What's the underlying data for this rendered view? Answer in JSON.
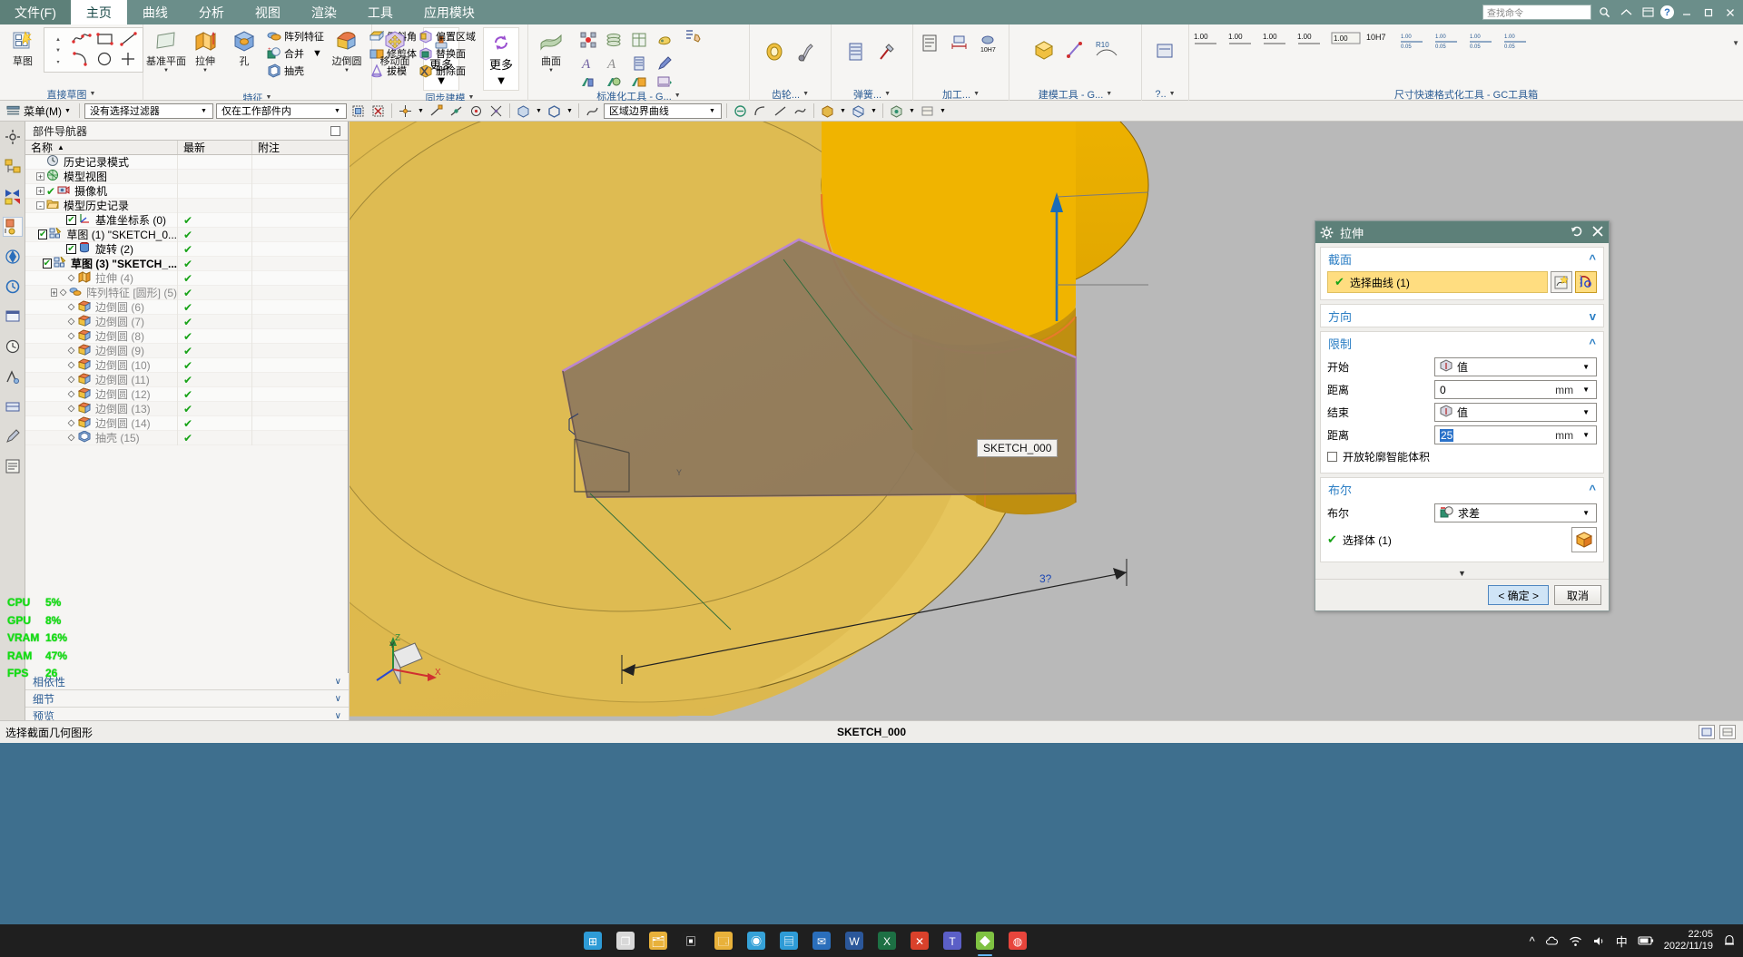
{
  "menubar": {
    "file_label": "文件(F)",
    "tabs": [
      {
        "label": "主页",
        "active": true
      },
      {
        "label": "曲线",
        "active": false
      },
      {
        "label": "分析",
        "active": false
      },
      {
        "label": "视图",
        "active": false
      },
      {
        "label": "渲染",
        "active": false
      },
      {
        "label": "工具",
        "active": false
      },
      {
        "label": "应用模块",
        "active": false
      }
    ],
    "search_placeholder": "查找命令",
    "window_controls": [
      "minimize",
      "maximize",
      "close"
    ]
  },
  "ribbon": {
    "groups": [
      {
        "label": "直接草图",
        "big": [
          {
            "label": "草图",
            "icon": "sketch-icon"
          }
        ],
        "grid": [
          "spline-icon",
          "rectangle-icon",
          "line-icon",
          "arc-icon",
          "circle-icon",
          "point-icon"
        ]
      },
      {
        "label": "特征",
        "big": [
          {
            "label": "基准平面",
            "icon": "datum-plane-icon",
            "dropdown": true
          },
          {
            "label": "拉伸",
            "icon": "extrude-icon",
            "dropdown": true
          },
          {
            "label": "孔",
            "icon": "hole-icon",
            "dropdown": false
          }
        ],
        "small": [
          "阵列特征",
          "合并",
          "抽壳"
        ],
        "big2": [
          {
            "label": "边倒圆",
            "icon": "edge-blend-icon",
            "dropdown": true
          }
        ],
        "small2": [
          "倒斜角",
          "修剪体",
          "拔模"
        ],
        "more": "更多"
      },
      {
        "label": "同步建模",
        "big": [
          {
            "label": "移动面",
            "icon": "move-face-icon"
          }
        ],
        "small": [
          "偏置区域",
          "替换面",
          "删除面"
        ],
        "more": "更多"
      },
      {
        "label": "标准化工具 - G...",
        "big": [
          {
            "label": "曲面",
            "icon": "surface-icon",
            "dropdown": true
          }
        ],
        "icons": [
          "pattern-icon",
          "layers-icon",
          "table-icon",
          "tag-icon",
          "text-a-icon",
          "text-b-icon",
          "stack-icon",
          "pen-icon"
        ]
      },
      {
        "label": "齿轮..."
      },
      {
        "label": "弹簧..."
      },
      {
        "label": "加工..."
      },
      {
        "label": "建模工具 - G..."
      },
      {
        "label": "?.."
      },
      {
        "label": "尺寸快速格式化工具 - GC工具箱"
      }
    ]
  },
  "selbar": {
    "menu_label": "菜单(M)",
    "filter_value": "没有选择过滤器",
    "scope_value": "仅在工作部件内",
    "curve_rule_value": "区域边界曲线"
  },
  "part_navigator": {
    "title": "部件导航器",
    "columns": [
      "名称",
      "最新",
      "附注"
    ],
    "sort_indicator": "▲",
    "items": [
      {
        "label": "历史记录模式",
        "icon": "clock-icon",
        "indent": 0,
        "mark": "none",
        "latest": "",
        "style": "normal",
        "expander": ""
      },
      {
        "label": "模型视图",
        "icon": "model-view-icon",
        "indent": 0,
        "mark": "none",
        "latest": "",
        "style": "normal",
        "expander": "+"
      },
      {
        "label": "摄像机",
        "icon": "camera-icon",
        "indent": 0,
        "mark": "check",
        "latest": "",
        "style": "normal",
        "expander": "+"
      },
      {
        "label": "模型历史记录",
        "icon": "folder-icon",
        "indent": 0,
        "mark": "none",
        "latest": "",
        "style": "normal",
        "expander": "-"
      },
      {
        "label": "基准坐标系 (0)",
        "icon": "csys-icon",
        "indent": 1,
        "mark": "checkbox",
        "latest": "✔",
        "style": "normal",
        "expander": ""
      },
      {
        "label": "草图 (1) \"SKETCH_0...",
        "icon": "sketch-small-icon",
        "indent": 1,
        "mark": "checkbox",
        "latest": "✔",
        "style": "normal",
        "expander": ""
      },
      {
        "label": "旋转 (2)",
        "icon": "revolve-icon",
        "indent": 1,
        "mark": "checkbox",
        "latest": "✔",
        "style": "normal",
        "expander": ""
      },
      {
        "label": "草图 (3) \"SKETCH_...",
        "icon": "sketch-small-icon",
        "indent": 1,
        "mark": "checkbox",
        "latest": "✔",
        "style": "bold",
        "expander": ""
      },
      {
        "label": "拉伸 (4)",
        "icon": "extrude-small-icon",
        "indent": 1,
        "mark": "diamond",
        "latest": "✔",
        "style": "grey",
        "expander": ""
      },
      {
        "label": "阵列特征 [圆形] (5)",
        "icon": "pattern-small-icon",
        "indent": 1,
        "mark": "diamond",
        "latest": "✔",
        "style": "grey",
        "expander": "+"
      },
      {
        "label": "边倒圆 (6)",
        "icon": "blend-small-icon",
        "indent": 1,
        "mark": "diamond",
        "latest": "✔",
        "style": "grey",
        "expander": ""
      },
      {
        "label": "边倒圆 (7)",
        "icon": "blend-small-icon",
        "indent": 1,
        "mark": "diamond",
        "latest": "✔",
        "style": "grey",
        "expander": ""
      },
      {
        "label": "边倒圆 (8)",
        "icon": "blend-small-icon",
        "indent": 1,
        "mark": "diamond",
        "latest": "✔",
        "style": "grey",
        "expander": ""
      },
      {
        "label": "边倒圆 (9)",
        "icon": "blend-small-icon",
        "indent": 1,
        "mark": "diamond",
        "latest": "✔",
        "style": "grey",
        "expander": ""
      },
      {
        "label": "边倒圆 (10)",
        "icon": "blend-small-icon",
        "indent": 1,
        "mark": "diamond",
        "latest": "✔",
        "style": "grey",
        "expander": ""
      },
      {
        "label": "边倒圆 (11)",
        "icon": "blend-small-icon",
        "indent": 1,
        "mark": "diamond",
        "latest": "✔",
        "style": "grey",
        "expander": ""
      },
      {
        "label": "边倒圆 (12)",
        "icon": "blend-small-icon",
        "indent": 1,
        "mark": "diamond",
        "latest": "✔",
        "style": "grey",
        "expander": ""
      },
      {
        "label": "边倒圆 (13)",
        "icon": "blend-small-icon",
        "indent": 1,
        "mark": "diamond",
        "latest": "✔",
        "style": "grey",
        "expander": ""
      },
      {
        "label": "边倒圆 (14)",
        "icon": "blend-small-icon",
        "indent": 1,
        "mark": "diamond",
        "latest": "✔",
        "style": "grey",
        "expander": ""
      },
      {
        "label": "抽壳 (15)",
        "icon": "shell-small-icon",
        "indent": 1,
        "mark": "diamond",
        "latest": "✔",
        "style": "grey",
        "expander": ""
      }
    ],
    "collapsers": [
      "相依性",
      "细节",
      "预览"
    ]
  },
  "perf_overlay": {
    "color": "#13e013",
    "rows": [
      {
        "key": "CPU",
        "value": "5%"
      },
      {
        "key": "GPU",
        "value": "8%"
      },
      {
        "key": "VRAM",
        "value": "16%"
      },
      {
        "key": "RAM",
        "value": "47%"
      },
      {
        "key": "FPS",
        "value": "26"
      }
    ]
  },
  "graphics": {
    "sketch_tag": "SKETCH_000",
    "dimension_value": "3?",
    "triad_labels": {
      "x": "X",
      "y": "Y",
      "z": "Z"
    },
    "background_color": "#b9b9b9",
    "body_color": "#e3b83a",
    "accent_color": "#f0a500"
  },
  "dialog": {
    "title": "拉伸",
    "title_icon": "gear-icon",
    "reset_icon": "reset-icon",
    "close_icon": "close-icon",
    "sections": [
      {
        "name": "截面",
        "expanded": true,
        "select_label": "选择曲线 (1)",
        "select_check": "✔",
        "buttons": [
          "specify-curve-icon",
          "sketch-section-icon"
        ]
      },
      {
        "name": "方向",
        "expanded": false
      },
      {
        "name": "限制",
        "expanded": true,
        "fields": [
          {
            "label": "开始",
            "type": "select",
            "value": "值",
            "icon": "value-icon"
          },
          {
            "label": "距离",
            "type": "number",
            "value": "0",
            "unit": "mm",
            "selected": false
          },
          {
            "label": "结束",
            "type": "select",
            "value": "值",
            "icon": "value-icon"
          },
          {
            "label": "距离",
            "type": "number",
            "value": "25",
            "unit": "mm",
            "selected": true
          }
        ],
        "checkbox": {
          "label": "开放轮廓智能体积",
          "checked": false
        }
      },
      {
        "name": "布尔",
        "expanded": true,
        "fields": [
          {
            "label": "布尔",
            "type": "select",
            "value": "求差",
            "icon": "subtract-icon"
          }
        ],
        "select_label": "选择体 (1)",
        "select_check": "✔",
        "body_button": "body-icon"
      }
    ],
    "more_arrow": "▼",
    "ok_label": "< 确定 >",
    "cancel_label": "取消"
  },
  "status_bar": {
    "message": "选择截面几何图形",
    "center_label": "SKETCH_000"
  },
  "taskbar": {
    "items": [
      {
        "name": "start-icon",
        "glyph": "⊞",
        "color": "#2e9bd6"
      },
      {
        "name": "task-view-icon",
        "glyph": "❐",
        "color": "#d8d8d8"
      },
      {
        "name": "explorer-icon",
        "glyph": "🗂",
        "color": "#e8b13a"
      },
      {
        "name": "terminal-icon",
        "glyph": "▣",
        "color": "#202020"
      },
      {
        "name": "files-icon",
        "glyph": "🗔",
        "color": "#e8b13a"
      },
      {
        "name": "edge-icon",
        "glyph": "◉",
        "color": "#36a2d8"
      },
      {
        "name": "store-icon",
        "glyph": "▤",
        "color": "#2e9bd6"
      },
      {
        "name": "mail-icon",
        "glyph": "✉",
        "color": "#2a6ebb"
      },
      {
        "name": "word-icon",
        "glyph": "W",
        "color": "#2b579a"
      },
      {
        "name": "excel-icon",
        "glyph": "X",
        "color": "#1d7044"
      },
      {
        "name": "wps-icon",
        "glyph": "✕",
        "color": "#d9412b"
      },
      {
        "name": "teams-icon",
        "glyph": "T",
        "color": "#5b5fc7"
      },
      {
        "name": "nx-icon",
        "glyph": "◆",
        "color": "#7fc242",
        "active": true
      },
      {
        "name": "chrome-icon",
        "glyph": "◍",
        "color": "#e8453c"
      }
    ],
    "tray": [
      "^",
      "cloud-icon",
      "network-icon",
      "volume-icon",
      "中",
      "battery-icon"
    ],
    "clock_time": "22:05",
    "clock_date": "2022/11/19"
  }
}
